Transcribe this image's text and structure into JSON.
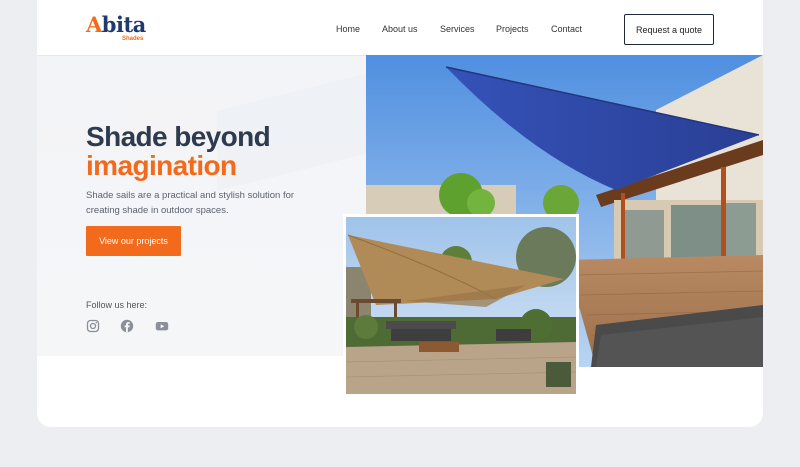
{
  "brand": {
    "name_first": "A",
    "name_rest": "bita",
    "sub": "Shades",
    "accent": "#f26a1b",
    "primary": "#1e3a6e"
  },
  "nav": {
    "items": [
      "Home",
      "About us",
      "Services",
      "Projects",
      "Contact"
    ],
    "cta": "Request a quote"
  },
  "hero": {
    "title_line1": "Shade beyond",
    "title_line2": "imagination",
    "description": "Shade sails are a practical and stylish solution for creating shade in outdoor spaces.",
    "button": "View our projects",
    "follow_label": "Follow us here:",
    "social_icons": [
      "instagram-icon",
      "facebook-icon",
      "youtube-icon"
    ]
  },
  "images": {
    "main": "blue shade sail over wooden deck with modern house",
    "secondary": "tan shade sail over patio with outdoor furniture"
  }
}
